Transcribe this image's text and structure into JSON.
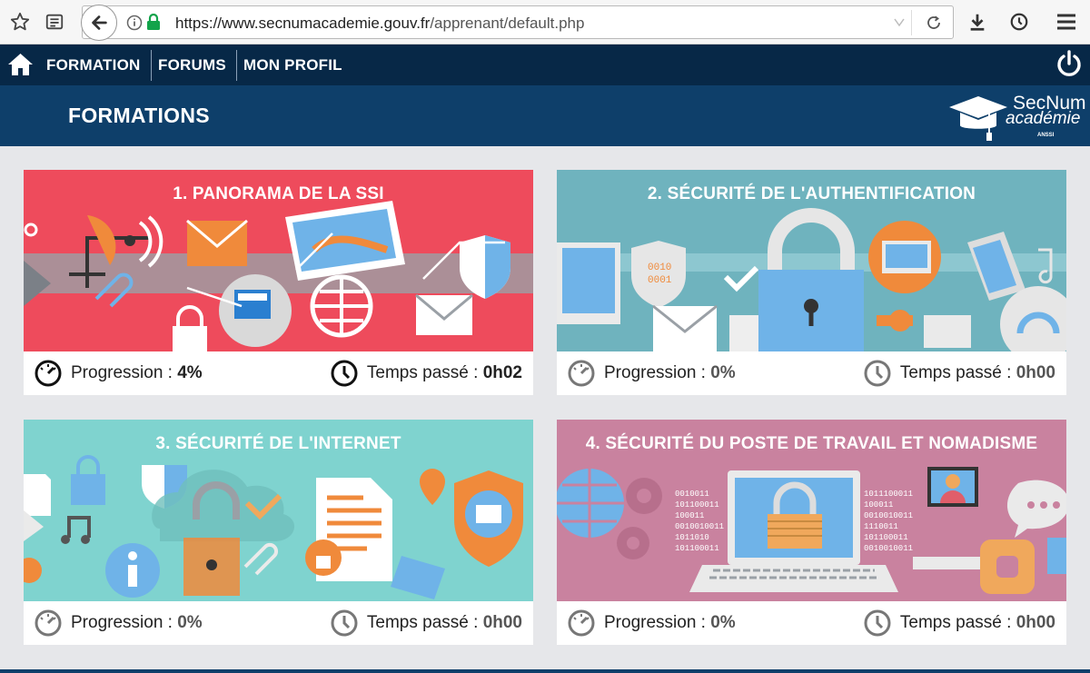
{
  "browser": {
    "url_host": "https://www.secnumacademie.gouv.fr",
    "url_path": "/apprenant/default.php"
  },
  "nav": {
    "items": [
      {
        "label": "FORMATION"
      },
      {
        "label": "FORUMS"
      },
      {
        "label": "MON PROFIL"
      }
    ]
  },
  "banner": {
    "title": "FORMATIONS",
    "logo_line1": "SecNum",
    "logo_line2": "académie",
    "logo_line3": "ANSSI"
  },
  "courses": [
    {
      "title": "1. PANORAMA DE LA SSI",
      "progress_label": "Progression :",
      "progress": "4%",
      "time_label": "Temps passé :",
      "time": "0h02",
      "color": "#ee4b5c"
    },
    {
      "title": "2. SÉCURITÉ DE L'AUTHENTIFICATION",
      "progress_label": "Progression :",
      "progress": "0%",
      "time_label": "Temps passé :",
      "time": "0h00",
      "color": "#6fb3be"
    },
    {
      "title": "3. SÉCURITÉ DE L'INTERNET",
      "progress_label": "Progression :",
      "progress": "0%",
      "time_label": "Temps passé :",
      "time": "0h00",
      "color": "#7fd3cf"
    },
    {
      "title": "4. SÉCURITÉ DU POSTE DE TRAVAIL ET NOMADISME",
      "progress_label": "Progression :",
      "progress": "0%",
      "time_label": "Temps passé :",
      "time": "0h00",
      "color": "#c9829f"
    }
  ]
}
